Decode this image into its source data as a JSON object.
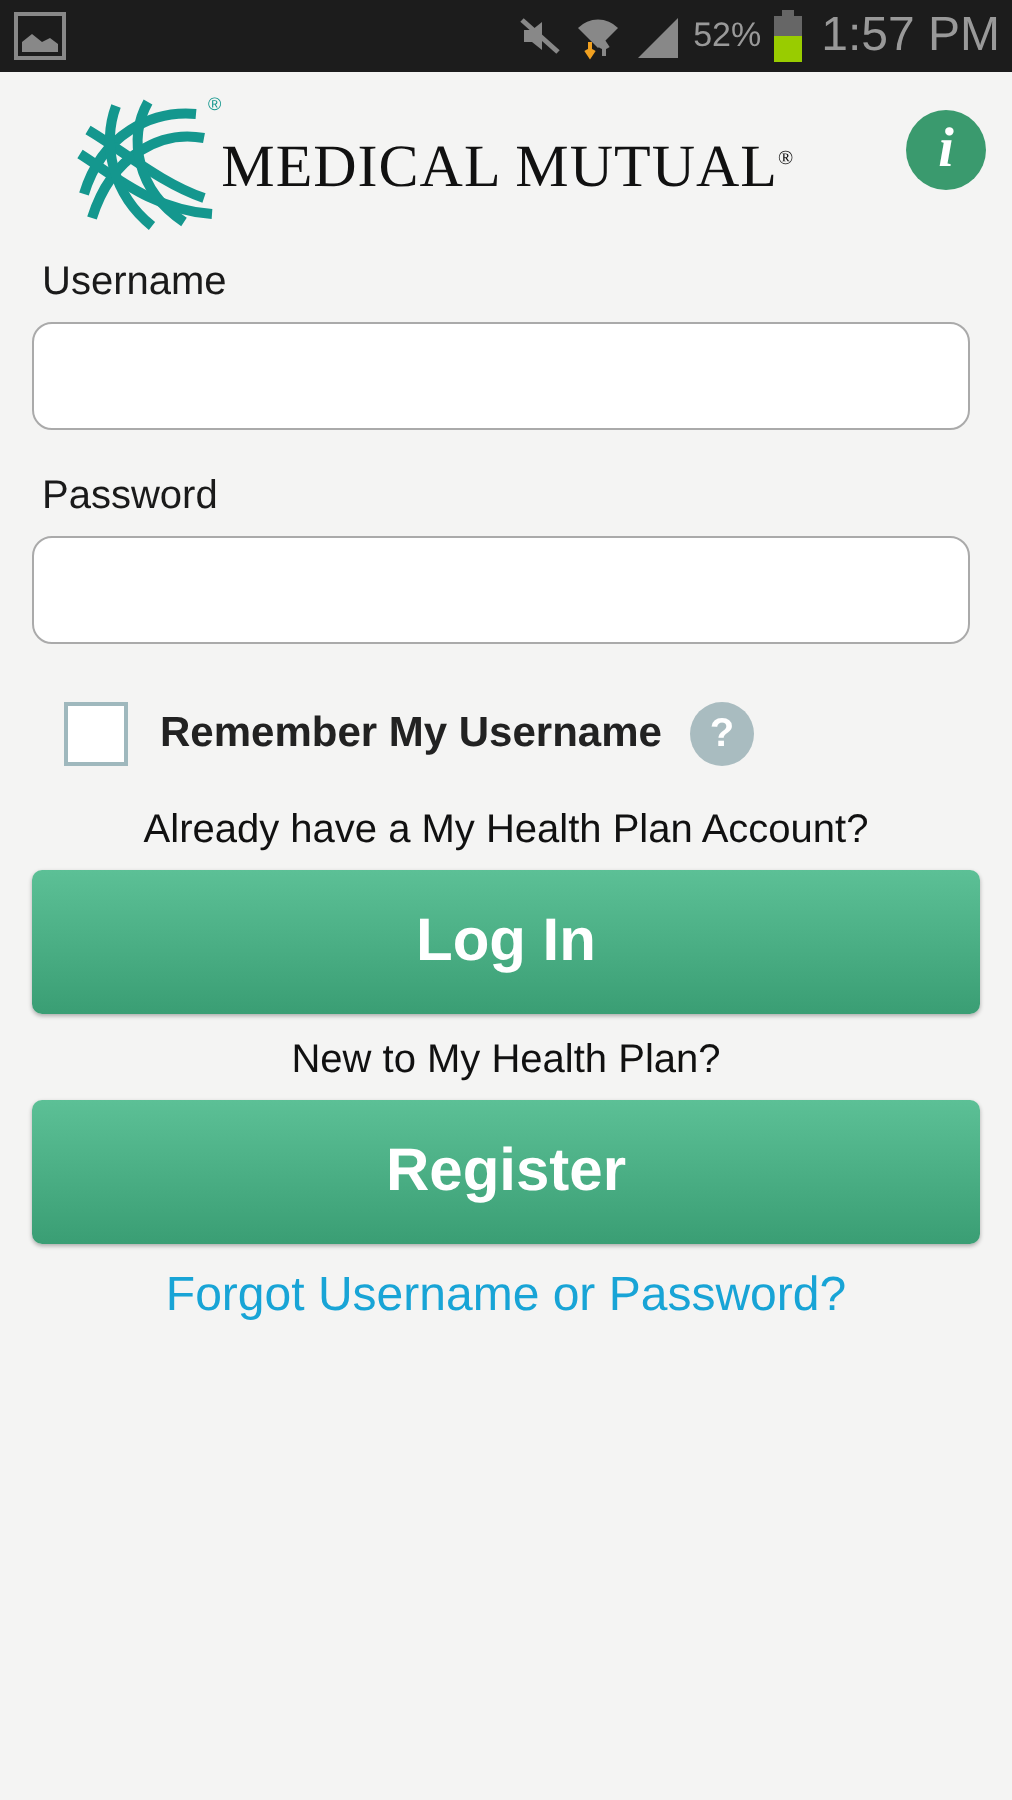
{
  "status_bar": {
    "battery": "52%",
    "time": "1:57 PM"
  },
  "header": {
    "logo_text": "MEDICAL MUTUAL$^{®}$",
    "logo_mark": "®",
    "info_button": "i"
  },
  "form": {
    "username_label": "Username",
    "password_label": "Password",
    "remember": {
      "label": "Remember My Username",
      "checked": false,
      "help": "?"
    }
  },
  "login_prompt": "Already have a My Health Plan Account?",
  "login_button": "Log In",
  "register_prompt": "New to My Health Plan?",
  "register_button": "Register",
  "forgot_link": "Forgot Username or Password?"
}
